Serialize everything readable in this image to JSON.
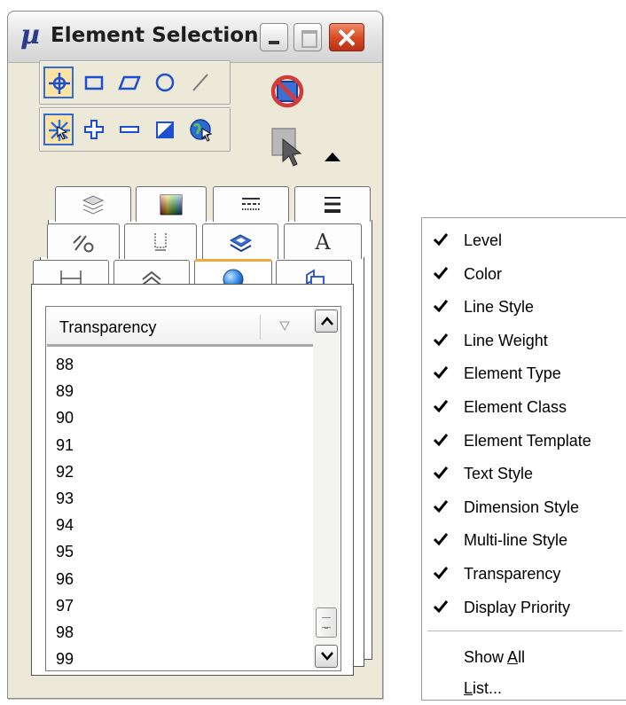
{
  "window": {
    "title": "Element Selection",
    "app_glyph": "µ",
    "titlebar_buttons": [
      "minimize",
      "maximize",
      "close"
    ]
  },
  "tools": {
    "row1": [
      "individual-selection-icon",
      "block-icon",
      "shape-icon",
      "circle-icon",
      "line-icon"
    ],
    "row2": [
      "new-selection-icon",
      "add-icon",
      "subtract-icon",
      "invert-icon",
      "toggle-icon"
    ],
    "side": [
      "clear-selection-icon",
      "select-all-icon"
    ]
  },
  "tabs": {
    "row_back": [
      "levels-icon",
      "color-icon",
      "line-style-icon",
      "line-weight-icon"
    ],
    "row_middle": [
      "element-type-icon",
      "element-class-icon",
      "element-template-icon",
      "text-style-glyph"
    ],
    "row_middle_text": "A",
    "row_front": [
      "dimension-style-icon",
      "multi-line-style-icon",
      "transparency-icon",
      "display-priority-icon"
    ]
  },
  "list": {
    "header": "Transparency",
    "values": [
      "88",
      "89",
      "90",
      "91",
      "92",
      "93",
      "94",
      "95",
      "96",
      "97",
      "98",
      "99"
    ]
  },
  "context_menu": {
    "checked_items": [
      "Level",
      "Color",
      "Line Style",
      "Line Weight",
      "Element Type",
      "Element Class",
      "Element Template",
      "Text Style",
      "Dimension Style",
      "Multi-line Style",
      "Transparency",
      "Display Priority"
    ],
    "show_all": "Show All",
    "list": "List..."
  }
}
